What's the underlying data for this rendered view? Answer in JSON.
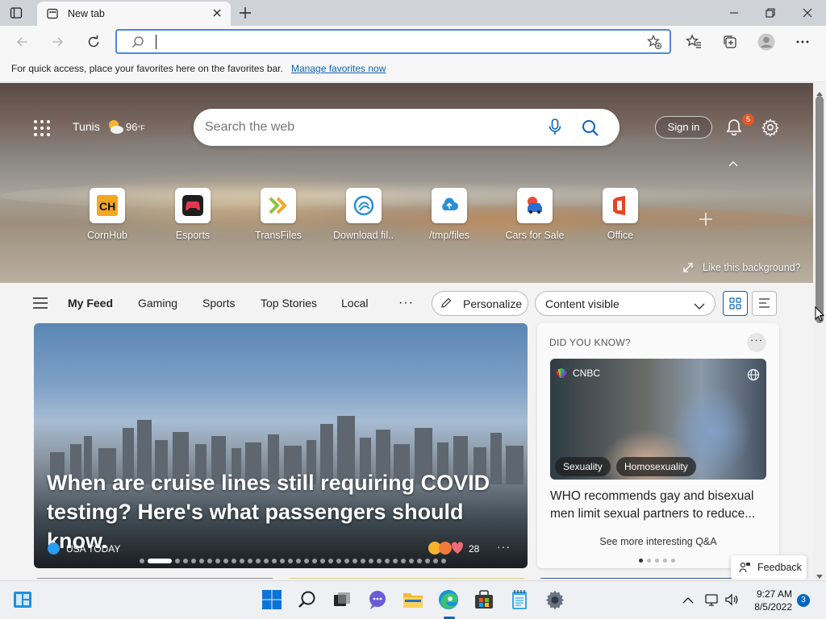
{
  "browser": {
    "tab": {
      "title": "New tab"
    },
    "address": {
      "value": "",
      "placeholder": ""
    },
    "favorites_bar": {
      "message": "For quick access, place your favorites here on the favorites bar.",
      "link": "Manage favorites now"
    }
  },
  "header": {
    "weather": {
      "city": "Tunis",
      "temp": "96",
      "unit": "°F",
      "icon": "partly-sunny-icon"
    },
    "search": {
      "placeholder": "Search the web"
    },
    "signin_label": "Sign in",
    "notification_count": "5"
  },
  "quick_links": [
    {
      "label": "CornHub",
      "icon": "cornhub-icon"
    },
    {
      "label": "Esports",
      "icon": "gamepad-icon"
    },
    {
      "label": "TransFiles",
      "icon": "transfiles-icon"
    },
    {
      "label": "Download fil...",
      "icon": "download-cloud-icon"
    },
    {
      "label": "/tmp/files",
      "icon": "upload-cloud-icon"
    },
    {
      "label": "Cars for Sale",
      "icon": "car-icon"
    },
    {
      "label": "Office",
      "icon": "office-icon"
    }
  ],
  "background": {
    "like_label": "Like this background?"
  },
  "feed_nav": {
    "tabs": [
      "My Feed",
      "Gaming",
      "Sports",
      "Top Stories",
      "Local"
    ],
    "active": "My Feed",
    "more": "···",
    "personalize_label": "Personalize",
    "content_visibility": "Content visible"
  },
  "main_story": {
    "headline": "When are cruise lines still requiring COVID testing? Here's what passengers should know.",
    "source": "USA TODAY",
    "reaction_count": "28",
    "slide_count": 36,
    "active_slide": 1
  },
  "side_card": {
    "title": "DID YOU KNOW?",
    "source": "CNBC",
    "tags": [
      "Sexuality",
      "Homosexuality"
    ],
    "headline": "WHO recommends gay and bisexual men limit sexual partners to reduce...",
    "see_more": "See more interesting Q&A",
    "page_count": 5,
    "active_page": 1
  },
  "feedback_label": "Feedback",
  "taskbar": {
    "time": "9:27 AM",
    "date": "8/5/2022",
    "notification_count": "3"
  },
  "colors": {
    "accent": "#0067c0",
    "link": "#0b62b8",
    "badge": "#e0582d"
  }
}
